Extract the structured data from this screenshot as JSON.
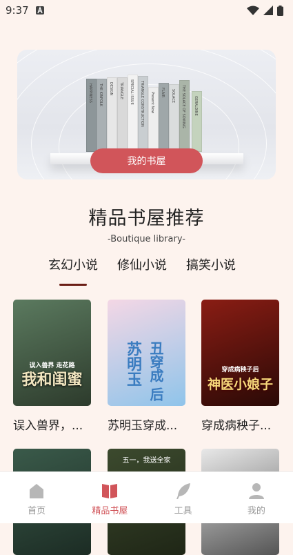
{
  "status_bar": {
    "time": "9:37",
    "notification_icon": "a-icon"
  },
  "banner": {
    "button_label": "我的书屋",
    "book_titles": [
      "HAPPINESS",
      "THE KINFOLK",
      "DESIGN",
      "TRIANGLE",
      "SPECIAL ISSUE",
      "TRIANGLE CONSTRUCTION",
      "Present Now",
      "FLAIR",
      "SOLACE",
      "THE SOLACE OF SOWING",
      "GERALDINE"
    ]
  },
  "section": {
    "title": "精品书屋推荐",
    "subtitle": "-Boutique library-"
  },
  "tabs": [
    {
      "label": "玄幻小说",
      "active": true
    },
    {
      "label": "修仙小说",
      "active": false
    },
    {
      "label": "搞笑小说",
      "active": false
    }
  ],
  "books": [
    {
      "title": "误入兽界，...",
      "cover_text": "我和闺蜜",
      "cover_sub": "误入兽界 走花路",
      "cover_colors": [
        "#5b7a5f",
        "#2d3b2c"
      ]
    },
    {
      "title": "苏明玉穿成...",
      "cover_text": "苏明玉",
      "cover_sub": "丑穿成 后",
      "cover_colors": [
        "#f4d7e5",
        "#8fc4ea"
      ]
    },
    {
      "title": "穿成病秧子...",
      "cover_text": "神医小娘子",
      "cover_sub": "穿成病秧子后",
      "cover_colors": [
        "#8a1d14",
        "#2a0906"
      ]
    },
    {
      "title": "",
      "cover_text": "",
      "cover_sub": "",
      "cover_colors": [
        "#3a5a4a",
        "#1c2c24"
      ]
    },
    {
      "title": "",
      "cover_text": "五一，我送全家",
      "cover_sub": "",
      "cover_colors": [
        "#3c4a2e",
        "#1f2616"
      ]
    },
    {
      "title": "",
      "cover_text": "",
      "cover_sub": "",
      "cover_colors": [
        "#e8e8e8",
        "#555555"
      ]
    }
  ],
  "bottom_nav": [
    {
      "label": "首页",
      "icon": "home-icon",
      "active": false
    },
    {
      "label": "精品书屋",
      "icon": "book-icon",
      "active": true
    },
    {
      "label": "工具",
      "icon": "feather-icon",
      "active": false
    },
    {
      "label": "我的",
      "icon": "person-icon",
      "active": false
    }
  ],
  "colors": {
    "accent": "#d1555a",
    "tab_underline": "#6b1e16",
    "background": "#fdf3ee"
  }
}
